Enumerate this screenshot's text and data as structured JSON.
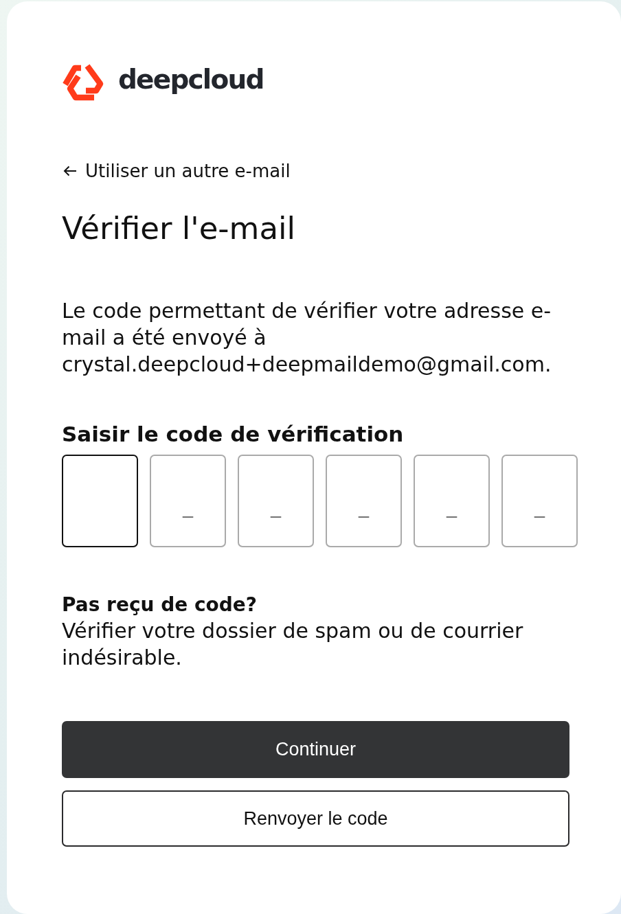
{
  "logo": {
    "name": "deepcloud"
  },
  "back_link": {
    "label": "Utiliser un autre e-mail"
  },
  "title": "Vérifier l'e-mail",
  "description": "Le code permettant de vérifier votre adresse e-mail a été envoyé à crystal.deepcloud+deepmaildemo@gmail.com.",
  "code_input": {
    "label": "Saisir le code de vérification",
    "cells": [
      {
        "focused": true
      },
      {
        "focused": false,
        "placeholder": "_"
      },
      {
        "focused": false,
        "placeholder": "_"
      },
      {
        "focused": false,
        "placeholder": "_"
      },
      {
        "focused": false,
        "placeholder": "_"
      },
      {
        "focused": false,
        "placeholder": "_"
      }
    ]
  },
  "help": {
    "title": "Pas reçu de code?",
    "text": "Vérifier votre dossier de spam ou de courrier indésirable."
  },
  "buttons": [
    {
      "label": "Continuer",
      "kind": "primary"
    },
    {
      "label": "Renvoyer le code",
      "kind": "secondary"
    }
  ]
}
